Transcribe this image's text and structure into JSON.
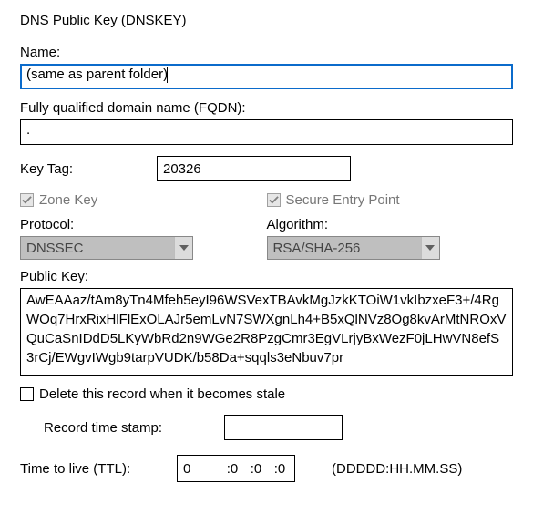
{
  "title": "DNS Public Key (DNSKEY)",
  "name": {
    "label": "Name:",
    "value": "(same as parent folder)"
  },
  "fqdn": {
    "label": "Fully qualified domain name (FQDN):",
    "value": "."
  },
  "keytag": {
    "label": "Key Tag:",
    "value": "20326"
  },
  "flags": {
    "zone_key": {
      "label": "Zone Key",
      "checked": true
    },
    "sep": {
      "label": "Secure Entry Point",
      "checked": true
    }
  },
  "protocol": {
    "label": "Protocol:",
    "value": "DNSSEC"
  },
  "algorithm": {
    "label": "Algorithm:",
    "value": "RSA/SHA-256"
  },
  "publickey": {
    "label": "Public Key:",
    "value": "AwEAAaz/tAm8yTn4Mfeh5eyI96WSVexTBAvkMgJzkKTOiW1vkIbzxeF3+/4RgWOq7HrxRixHlFlExOLAJr5emLvN7SWXgnLh4+B5xQlNVz8Og8kvArMtNROxVQuCaSnIDdD5LKyWbRd2n9WGe2R8PzgCmr3EgVLrjyBxWezF0jLHwVN8efS3rCj/EWgvIWgb9tarpVUDK/b58Da+sqqls3eNbuv7pr"
  },
  "stale": {
    "label": "Delete this record when it becomes stale",
    "checked": false
  },
  "rts": {
    "label": "Record time stamp:",
    "value": ""
  },
  "ttl": {
    "label": "Time to live (TTL):",
    "d": "0",
    "h": ":0",
    "m": ":0",
    "s": ":0",
    "hint": "(DDDDD:HH.MM.SS)"
  }
}
